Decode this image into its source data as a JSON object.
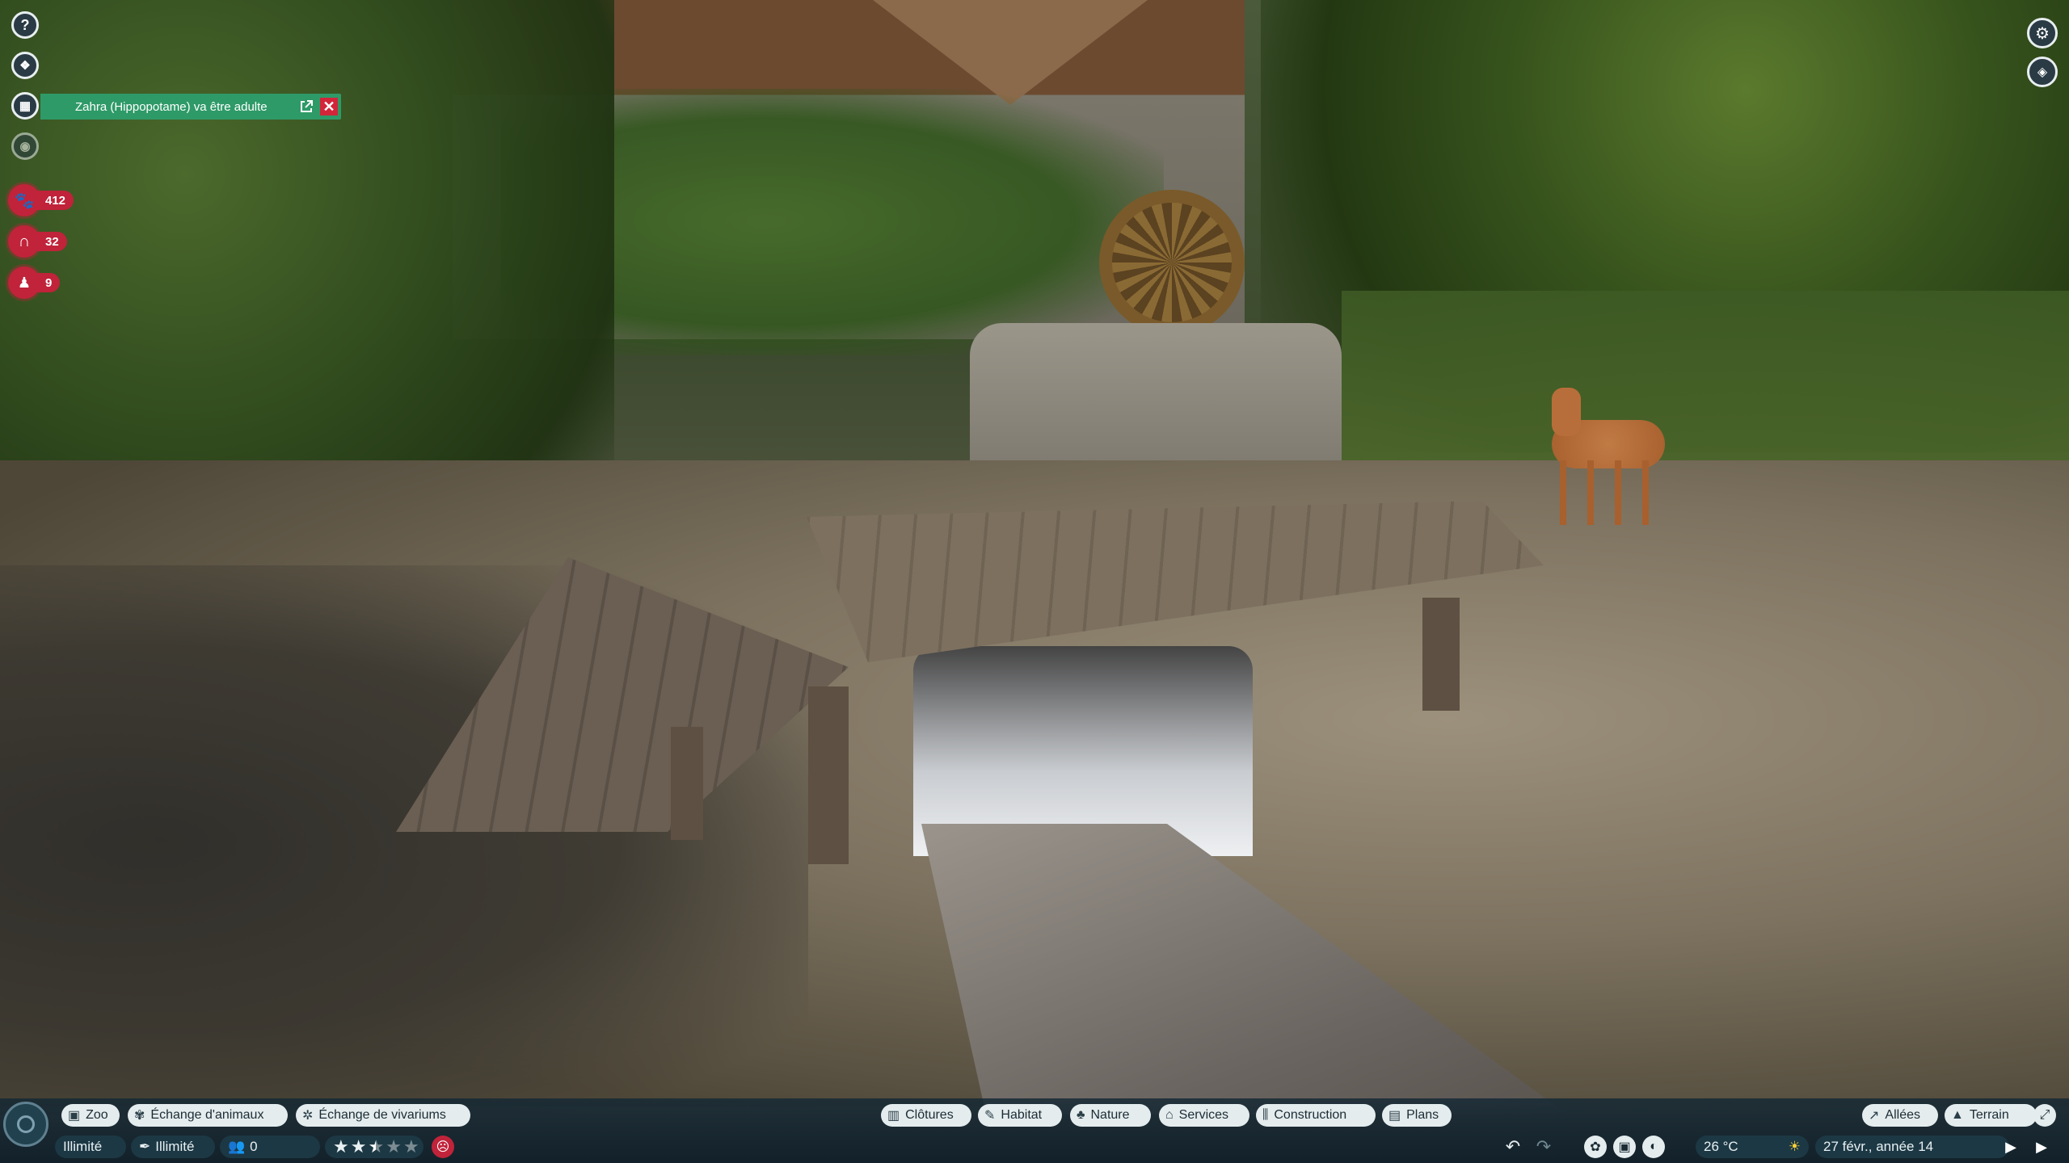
{
  "notification": {
    "text": "Zahra (Hippopotame) va être adulte",
    "open_icon": "external-link-icon",
    "close_icon": "close-icon"
  },
  "left_toolbar": {
    "help_icon": "question-icon",
    "animals_icon": "animal-info-icon",
    "calendar_icon": "calendar-icon",
    "view_icon": "eye-icon"
  },
  "stats": {
    "animals": "412",
    "facilities": "32",
    "staff": "9"
  },
  "top_right": {
    "settings_icon": "gear-icon",
    "camera_icon": "camera-mode-icon"
  },
  "bottom_left_tabs": {
    "zoo": "Zoo",
    "animal_trading": "Échange d'animaux",
    "exhibit_trading": "Échange de vivariums"
  },
  "build_tabs": {
    "fences": "Clôtures",
    "habitat": "Habitat",
    "nature": "Nature",
    "services": "Services",
    "construction": "Construction",
    "blueprints": "Plans"
  },
  "right_tabs": {
    "paths": "Allées",
    "terrain": "Terrain"
  },
  "status": {
    "money": "Illimité",
    "research": "Illimité",
    "guests": "0",
    "rating_stars": 2.5,
    "rating_max": 5,
    "temperature": "26 °C",
    "date": "27 févr., année 14"
  },
  "colors": {
    "notification_bg": "#2e9a68",
    "alert_red": "#c0233a",
    "bar_bg": "#14303c",
    "pill_bg": "#e4ecee"
  }
}
